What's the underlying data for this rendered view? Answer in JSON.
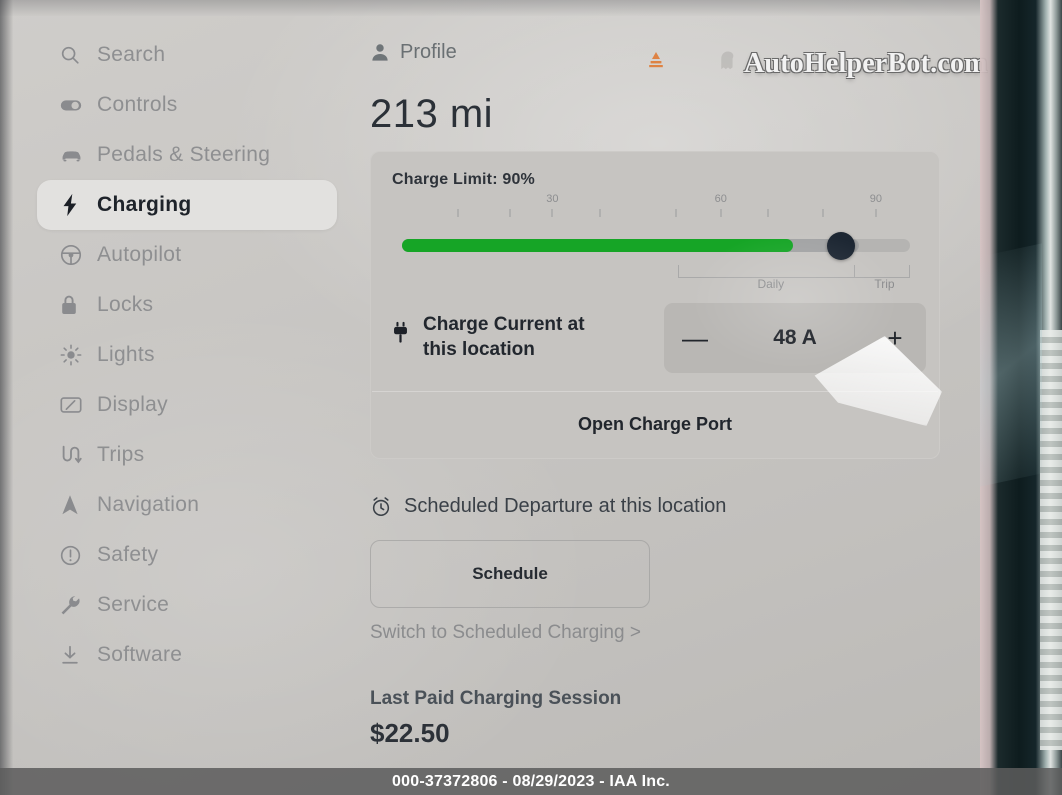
{
  "app": {
    "range_display": "213 mi",
    "watermark": "AutoHelperBot.com"
  },
  "sidebar": {
    "items": [
      {
        "label": "Search",
        "icon": "search-icon",
        "active": false
      },
      {
        "label": "Controls",
        "icon": "toggle-icon",
        "active": false
      },
      {
        "label": "Pedals & Steering",
        "icon": "car-icon",
        "active": false
      },
      {
        "label": "Charging",
        "icon": "bolt-icon",
        "active": true
      },
      {
        "label": "Autopilot",
        "icon": "steering-icon",
        "active": false
      },
      {
        "label": "Locks",
        "icon": "lock-icon",
        "active": false
      },
      {
        "label": "Lights",
        "icon": "light-icon",
        "active": false
      },
      {
        "label": "Display",
        "icon": "display-icon",
        "active": false
      },
      {
        "label": "Trips",
        "icon": "trips-icon",
        "active": false
      },
      {
        "label": "Navigation",
        "icon": "navigation-icon",
        "active": false
      },
      {
        "label": "Safety",
        "icon": "warning-icon",
        "active": false
      },
      {
        "label": "Service",
        "icon": "wrench-icon",
        "active": false
      },
      {
        "label": "Software",
        "icon": "download-icon",
        "active": false
      }
    ]
  },
  "header": {
    "profile_label": "Profile",
    "profile_icon": "person-icon",
    "download_icon": "download-arrow-icon",
    "ghost_icon": "ghost-icon"
  },
  "charge_card": {
    "charge_limit_label": "Charge Limit: 90%",
    "charge_limit_percent": 90,
    "slider": {
      "tick_labels": [
        "30",
        "60",
        "90"
      ],
      "tick_label_positions": [
        30,
        60,
        90
      ],
      "tick_count": 11,
      "daily_label": "Daily",
      "trip_label": "Trip",
      "green_fill_percent": 77,
      "knob_percent": 90,
      "track_color": "#16a526",
      "knob_color": "#1d2733"
    },
    "charge_current": {
      "icon": "plug-icon",
      "label_line1": "Charge Current at",
      "label_line2": "this location",
      "decrement_label": "—",
      "value": "48 A",
      "increment_label": "+"
    },
    "open_charge_port_label": "Open Charge Port"
  },
  "schedule": {
    "heading_icon": "alarm-clock-icon",
    "heading": "Scheduled Departure at this location",
    "button_label": "Schedule",
    "switch_link": "Switch to Scheduled Charging >"
  },
  "last_session": {
    "title": "Last Paid Charging Session",
    "amount": "$22.50"
  },
  "banner": {
    "text": "000-37372806 - 08/29/2023 - IAA Inc."
  },
  "colors": {
    "accent_green": "#16a526",
    "knob_dark": "#1d2733",
    "screen_bg": "#c8c6c3",
    "download_orange": "#e0762c"
  }
}
